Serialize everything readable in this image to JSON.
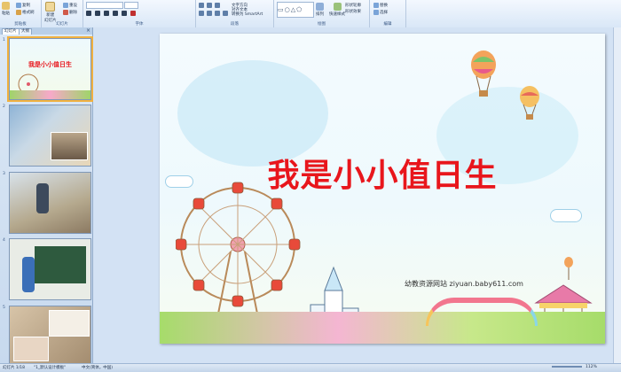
{
  "ribbon": {
    "groups": [
      "剪贴板",
      "幻灯片",
      "字体",
      "段落",
      "绘图",
      "编辑"
    ],
    "clipboard": {
      "copy": "复制",
      "format_painter": "格式刷",
      "paste": "粘贴"
    },
    "slides": {
      "new_slide": "新建\n幻灯片",
      "reset": "重设",
      "delete": "删除"
    },
    "paragraph": {
      "text_direction": "文字方向",
      "align_text": "对齐文本",
      "smartart": "转换为 SmartArt"
    },
    "drawing": {
      "arrange": "排列",
      "quick_styles": "快速样式",
      "shape_outline": "形状轮廓",
      "shape_effects": "形状效果"
    },
    "editing": {
      "replace": "替换",
      "select": "选择"
    }
  },
  "panel": {
    "tabs": [
      "幻灯片",
      "大纲"
    ],
    "close": "×",
    "thumb_title": "我是小小值日生",
    "slide_numbers": [
      "1",
      "2",
      "3",
      "4",
      "5"
    ]
  },
  "slide": {
    "title": "我是小小值日生",
    "credit": "幼教资源网站   ziyuan.baby611.com"
  },
  "status": {
    "slide_count": "幻灯片 1/18",
    "theme": "\"1_默认设计模板\"",
    "language": "中文(简体，中国)",
    "zoom": "112%"
  },
  "colors": {
    "title_red": "#e8161c",
    "selection": "#f1b13f",
    "ribbon_bg": "#dbe8f7"
  }
}
